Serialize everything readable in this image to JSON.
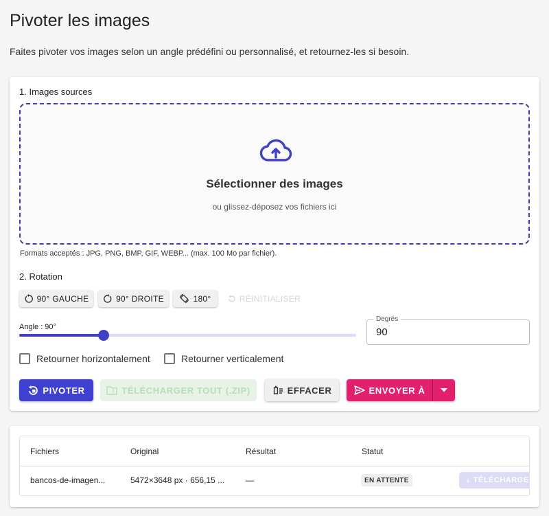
{
  "page": {
    "title": "Pivoter les images",
    "subtitle": "Faites pivoter vos images selon un angle prédéfini ou personnalisé, et retournez-les si besoin."
  },
  "sources": {
    "section_label": "1. Images sources",
    "dropzone_title": "Sélectionner des images",
    "dropzone_subtitle": "ou glissez-déposez vos fichiers ici",
    "formats_note": "Formats acceptés : JPG, PNG, BMP, GIF, WEBP... (max. 100 Mo par fichier)."
  },
  "rotation": {
    "section_label": "2. Rotation",
    "presets": [
      {
        "label": "90° GAUCHE",
        "icon": "rotate-left-icon"
      },
      {
        "label": "90° DROITE",
        "icon": "rotate-right-icon"
      },
      {
        "label": "180°",
        "icon": "rotate-180-icon"
      },
      {
        "label": "RÉINITIALISER",
        "icon": "reset-icon",
        "disabled": true
      }
    ],
    "angle_label": "Angle : 90°",
    "slider": {
      "value": 90,
      "min": 0,
      "max": 360
    },
    "degrees_label": "Degrés",
    "degrees_value": "90",
    "flip_horizontal_label": "Retourner horizontalement",
    "flip_vertical_label": "Retourner verticalement"
  },
  "actions": {
    "rotate_label": "PIVOTER",
    "download_all_label": "TÉLÉCHARGER TOUT (.ZIP)",
    "clear_label": "EFFACER",
    "send_label": "ENVOYER À"
  },
  "table": {
    "headers": {
      "files": "Fichiers",
      "original": "Original",
      "result": "Résultat",
      "status": "Statut"
    },
    "rows": [
      {
        "file": "bancos-de-imagen...",
        "original": "5472×3648 px · 656,15 ...",
        "result": "—",
        "status": "EN ATTENTE",
        "download_label": "TÉLÉCHARGER"
      }
    ]
  },
  "colors": {
    "primary": "#4040d0",
    "send": "#e3206e",
    "disabled_green": "#e6f3e6",
    "dropzone_border": "#3f3fa5"
  }
}
